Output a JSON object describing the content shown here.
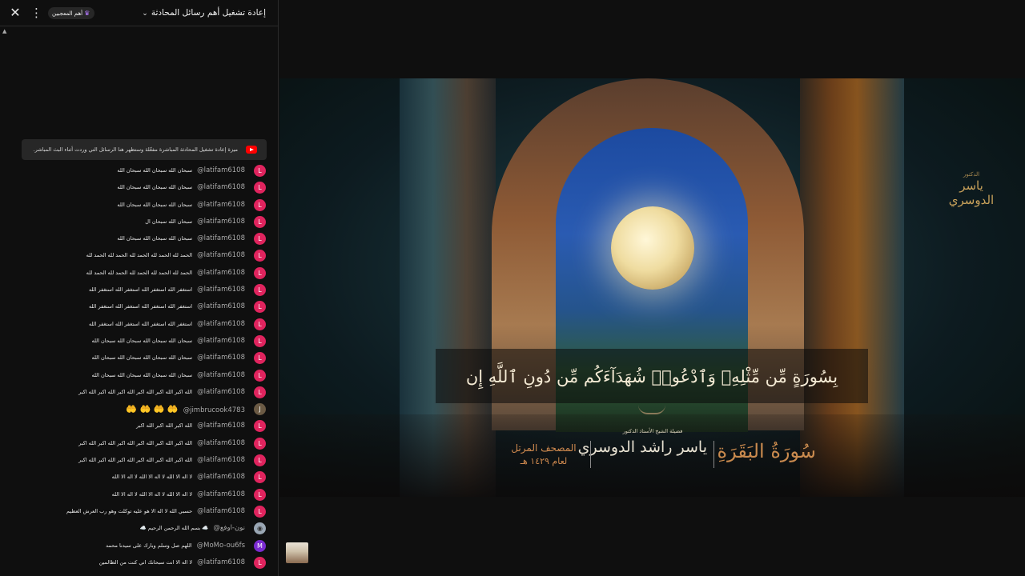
{
  "header": {
    "title": "إعادة تشغيل أهم رسائل المحادثة",
    "top_fans_label": "أهم المعجبين",
    "close_label": "✕",
    "more_label": "⋮"
  },
  "notice": {
    "text": "ميزة إعادة تشغيل المحادثة المباشرة مفعّلة وستظهر هنا الرسائل التي وردت أثناء البث المباشر."
  },
  "messages": [
    {
      "avatar": "L",
      "author": "@latifam6108",
      "text": "سبحان الله سبحان الله سبحان الله"
    },
    {
      "avatar": "L",
      "author": "@latifam6108",
      "text": "سبحان الله سبحان الله سبحان الله"
    },
    {
      "avatar": "L",
      "author": "@latifam6108",
      "text": "سبحان الله سبحان الله سبحان الله"
    },
    {
      "avatar": "L",
      "author": "@latifam6108",
      "text": "سبحان الله سبحان ال"
    },
    {
      "avatar": "L",
      "author": "@latifam6108",
      "text": "سبحان الله سبحان الله سبحان الله"
    },
    {
      "avatar": "L",
      "author": "@latifam6108",
      "text": "الحمد لله الحمد لله الحمد لله الحمد لله الحمد لله"
    },
    {
      "avatar": "L",
      "author": "@latifam6108",
      "text": "الحمد لله الحمد لله الحمد لله الحمد لله الحمد لله"
    },
    {
      "avatar": "L",
      "author": "@latifam6108",
      "text": "استغفر الله استغفر الله استغفر الله استغفر الله"
    },
    {
      "avatar": "L",
      "author": "@latifam6108",
      "text": "استغفر الله استغفر الله استغفر الله استغفر الله"
    },
    {
      "avatar": "L",
      "author": "@latifam6108",
      "text": "استغفر الله استغفر الله استغفر الله استغفر الله"
    },
    {
      "avatar": "L",
      "author": "@latifam6108",
      "text": "سبحان الله سبحان الله سبحان الله سبحان الله"
    },
    {
      "avatar": "L",
      "author": "@latifam6108",
      "text": "سبحان الله سبحان الله سبحان الله سبحان الله"
    },
    {
      "avatar": "L",
      "author": "@latifam6108",
      "text": "سبحان الله سبحان الله سبحان الله سبحان الله"
    },
    {
      "avatar": "L",
      "author": "@latifam6108",
      "text": "الله اكبر الله اكبر الله اكبر الله اكبر الله اكبر الله اكبر"
    },
    {
      "avatar": "J",
      "author": "@jimbrucook4783",
      "text": "🤲 🤲 🤲 🤲"
    },
    {
      "avatar": "L",
      "author": "@latifam6108",
      "text": "الله اكبر الله اكبر الله اكبر"
    },
    {
      "avatar": "L",
      "author": "@latifam6108",
      "text": "الله اكبر الله اكبر الله اكبر الله اكبر الله اكبر الله اكبر"
    },
    {
      "avatar": "L",
      "author": "@latifam6108",
      "text": "الله اكبر الله اكبر الله اكبر الله اكبر الله اكبر الله اكبر"
    },
    {
      "avatar": "L",
      "author": "@latifam6108",
      "text": "لا اله الا الله لا اله الا الله لا اله الا الله"
    },
    {
      "avatar": "L",
      "author": "@latifam6108",
      "text": "لا اله الا الله لا اله الا الله لا اله الا الله"
    },
    {
      "avatar": "L",
      "author": "@latifam6108",
      "text": "حسبي الله لا اله الا هو عليه توكلت وهو رب العرش العظيم"
    },
    {
      "avatar": "◉",
      "author": "@نون-اوفع",
      "text": "☁️ بسم الله الرحمن الرحيم ☁️"
    },
    {
      "avatar": "M",
      "author": "@MoMo-ou6fs",
      "text": "اللهم صل وسلم وبارك على سيدنا محمد"
    },
    {
      "avatar": "L",
      "author": "@latifam6108",
      "text": "لا اله الا انت سبحانك اني كنت من الظالمين"
    }
  ],
  "video": {
    "verse": "بِسُورَةٍ مِّن مِّثْلِهِۦ وَٱدْعُوا۟ شُهَدَآءَكُم مِّن دُونِ ٱللَّهِ إِن",
    "surah": "سُورَةُ البَقَرَةِ",
    "reciter_title": "فضيلة الشيخ الأستاذ الدكتور",
    "reciter_name": "ياسر راشد الدوسري",
    "mushaf_line1": "المصحف المرتل",
    "mushaf_line2": "لعام ١٤٢٩ هـ",
    "logo_small": "الدكتور",
    "logo_name": "ياسر الدوسري"
  },
  "colors": {
    "accent_avatar": "#e0245e",
    "surah_gold": "#c98a4e",
    "youtube_red": "#ff0000"
  }
}
